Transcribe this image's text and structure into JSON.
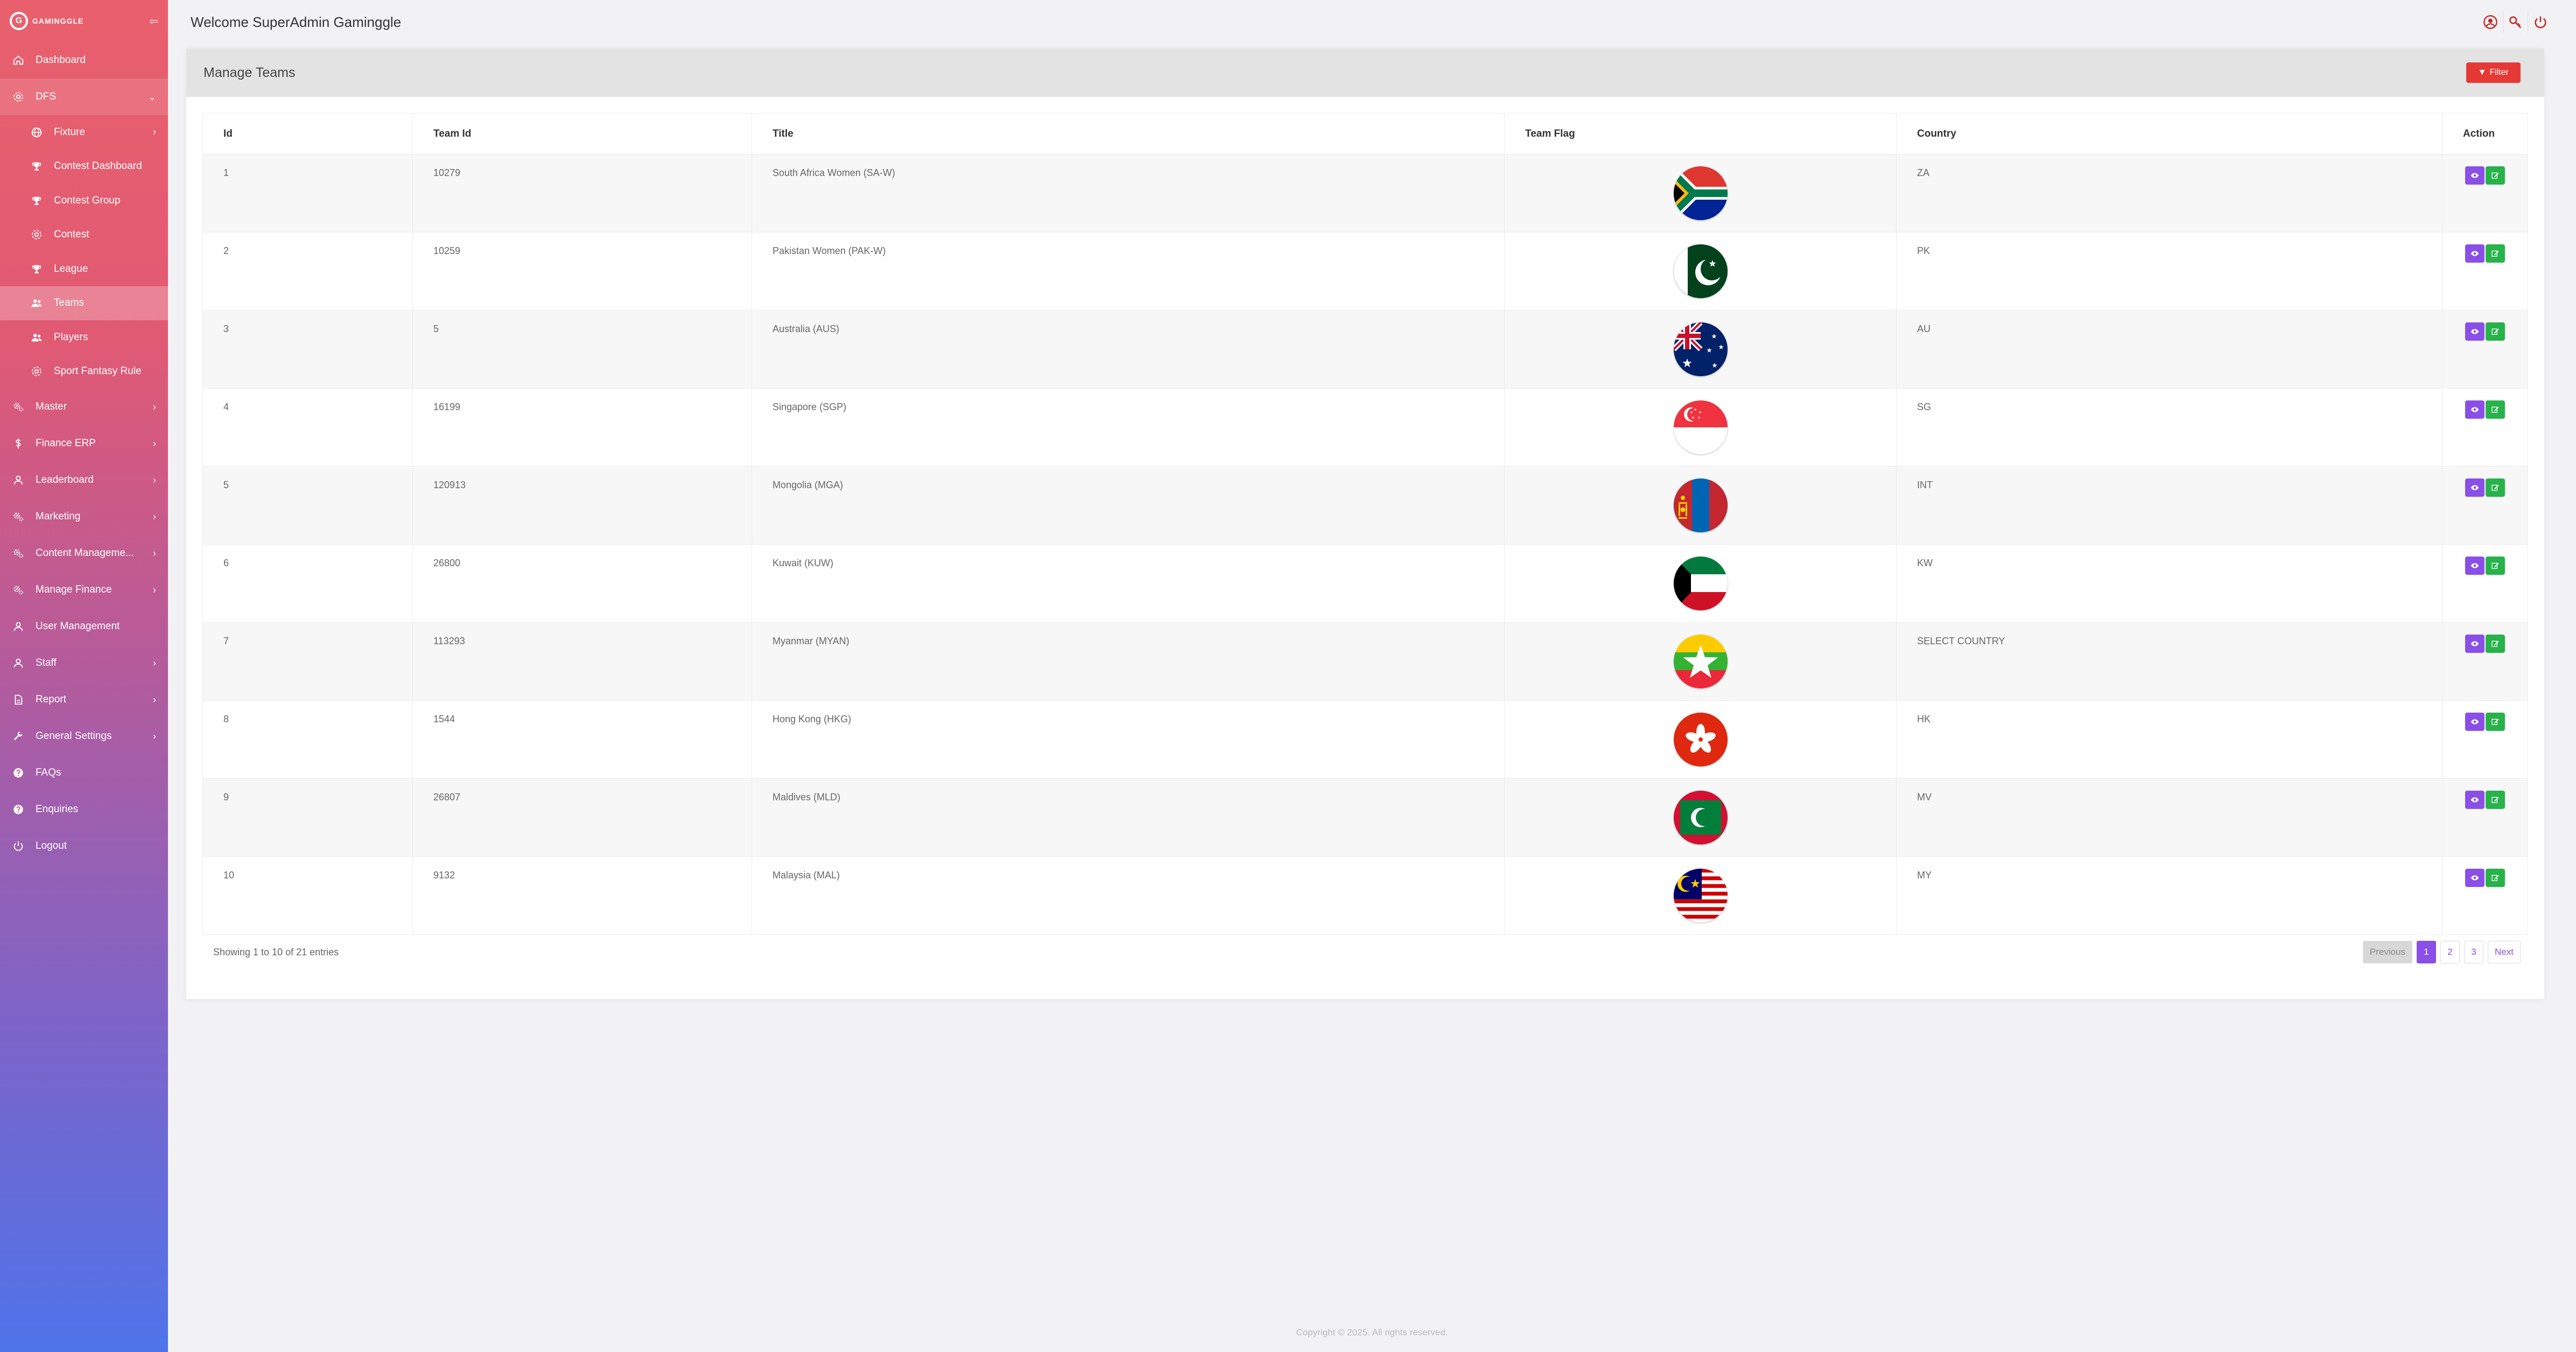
{
  "brand": {
    "logo_letter": "G",
    "name": "GAMINGGLE"
  },
  "header": {
    "welcome": "Welcome SuperAdmin Gaminggle"
  },
  "sidebar": {
    "items": [
      {
        "label": "Dashboard",
        "icon": "home-icon"
      },
      {
        "label": "DFS",
        "icon": "gear-icon",
        "expanded": true
      },
      {
        "label": "Fixture",
        "icon": "globe-icon"
      },
      {
        "label": "Contest Dashboard",
        "icon": "trophy-icon"
      },
      {
        "label": "Contest Group",
        "icon": "trophy-icon"
      },
      {
        "label": "Contest",
        "icon": "gear-icon"
      },
      {
        "label": "League",
        "icon": "trophy-icon"
      },
      {
        "label": "Teams",
        "icon": "users-icon",
        "active": true
      },
      {
        "label": "Players",
        "icon": "users-icon"
      },
      {
        "label": "Sport Fantasy Rule",
        "icon": "gear-icon"
      },
      {
        "label": "Master",
        "icon": "cogs-icon"
      },
      {
        "label": "Finance ERP",
        "icon": "dollar-icon"
      },
      {
        "label": "Leaderboard",
        "icon": "user-icon"
      },
      {
        "label": "Marketing",
        "icon": "cogs-icon"
      },
      {
        "label": "Content Manageme...",
        "icon": "cogs-icon"
      },
      {
        "label": "Manage Finance",
        "icon": "cogs-icon"
      },
      {
        "label": "User Management",
        "icon": "user-icon"
      },
      {
        "label": "Staff",
        "icon": "user-icon"
      },
      {
        "label": "Report",
        "icon": "file-icon"
      },
      {
        "label": "General Settings",
        "icon": "wrench-icon"
      },
      {
        "label": "FAQs",
        "icon": "question-icon"
      },
      {
        "label": "Enquiries",
        "icon": "question-icon"
      },
      {
        "label": "Logout",
        "icon": "power-icon"
      }
    ]
  },
  "card": {
    "title": "Manage Teams",
    "filter_label": "Filter"
  },
  "table": {
    "headers": [
      "Id",
      "Team Id",
      "Title",
      "Team Flag",
      "Country",
      "Action"
    ],
    "rows": [
      {
        "id": "1",
        "team_id": "10279",
        "title": "South Africa Women (SA-W)",
        "country": "ZA",
        "flag": "south-africa"
      },
      {
        "id": "2",
        "team_id": "10259",
        "title": "Pakistan Women (PAK-W)",
        "country": "PK",
        "flag": "pakistan"
      },
      {
        "id": "3",
        "team_id": "5",
        "title": "Australia (AUS)",
        "country": "AU",
        "flag": "australia"
      },
      {
        "id": "4",
        "team_id": "16199",
        "title": "Singapore (SGP)",
        "country": "SG",
        "flag": "singapore"
      },
      {
        "id": "5",
        "team_id": "120913",
        "title": "Mongolia (MGA)",
        "country": "INT",
        "flag": "mongolia"
      },
      {
        "id": "6",
        "team_id": "26800",
        "title": "Kuwait (KUW)",
        "country": "KW",
        "flag": "kuwait"
      },
      {
        "id": "7",
        "team_id": "113293",
        "title": "Myanmar (MYAN)",
        "country": "SELECT COUNTRY",
        "flag": "myanmar"
      },
      {
        "id": "8",
        "team_id": "1544",
        "title": "Hong Kong (HKG)",
        "country": "HK",
        "flag": "hong-kong"
      },
      {
        "id": "9",
        "team_id": "26807",
        "title": "Maldives (MLD)",
        "country": "MV",
        "flag": "maldives"
      },
      {
        "id": "10",
        "team_id": "9132",
        "title": "Malaysia (MAL)",
        "country": "MY",
        "flag": "malaysia"
      }
    ]
  },
  "footer": {
    "entries": "Showing 1 to 10 of 21 entries",
    "pagination": {
      "previous": "Previous",
      "pages": [
        "1",
        "2",
        "3"
      ],
      "current": "1",
      "next": "Next"
    },
    "copyright": "Copyright © 2025. All rights reserved."
  },
  "colors": {
    "view_button": "#8a4fe6",
    "edit_button": "#27b24a",
    "filter_button": "#e53935",
    "sidebar_top": "#e8606d",
    "sidebar_bottom": "#4f74ea"
  }
}
